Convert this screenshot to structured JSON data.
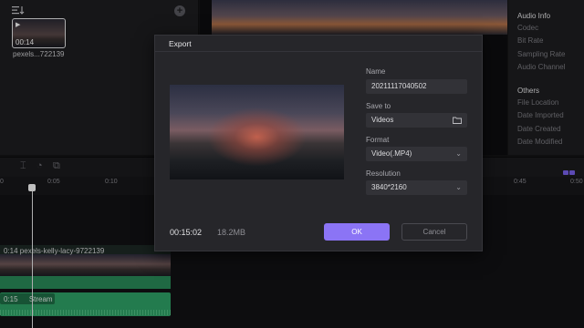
{
  "media": {
    "clip_duration": "00:14",
    "clip_name": "pexels...722139"
  },
  "info_panel": {
    "audio_heading": "Audio Info",
    "audio_items": [
      "Codec",
      "Bit Rate",
      "Sampling Rate",
      "Audio Channel"
    ],
    "others_heading": "Others",
    "others_items": [
      "File Location",
      "Date Imported",
      "Date Created",
      "Date Modified"
    ]
  },
  "timeline": {
    "ticks": [
      "0",
      "0:05",
      "0:10",
      "0:45",
      "0:50"
    ],
    "video_clip_label": "0:14   pexels-kelly-lacy-9722139",
    "audio_clip_time": "0:15",
    "audio_clip_name": "Stream"
  },
  "export_dialog": {
    "title": "Export",
    "name_label": "Name",
    "name_value": "20211117040502",
    "save_to_label": "Save to",
    "save_to_value": "Videos",
    "format_label": "Format",
    "format_value": "Video(.MP4)",
    "resolution_label": "Resolution",
    "resolution_value": "3840*2160",
    "duration": "00:15:02",
    "file_size": "18.2MB",
    "ok_label": "OK",
    "cancel_label": "Cancel"
  },
  "colors": {
    "accent": "#8b74f5",
    "clip_green": "#2fa568"
  }
}
